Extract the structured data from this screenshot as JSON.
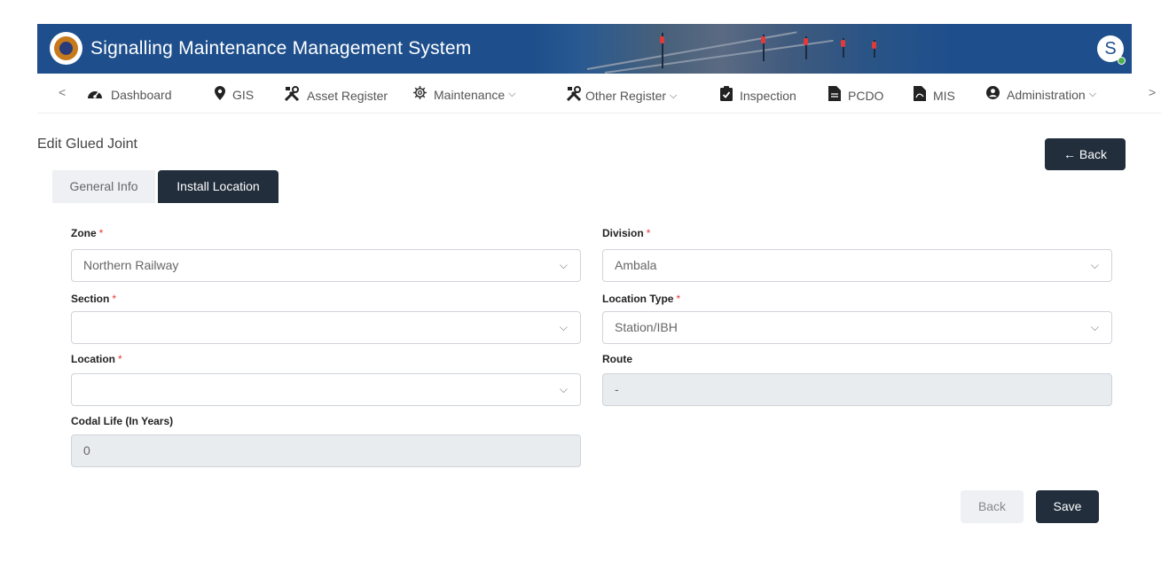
{
  "header": {
    "app_title": "Signalling Maintenance Management System",
    "avatar_initial": "S",
    "brand_color": "#1e4f8c"
  },
  "nav": {
    "prev_arrow": "<",
    "next_arrow": ">",
    "items": [
      {
        "label": "Dashboard",
        "icon": "dashboard-gauge-icon"
      },
      {
        "label": "GIS",
        "icon": "map-pin-icon"
      },
      {
        "label": "Asset Register",
        "icon": "tools-icon"
      },
      {
        "label": "Maintenance",
        "icon": "gear-icon",
        "has_dropdown": true
      },
      {
        "label": "Other Register",
        "icon": "tools-icon",
        "has_dropdown": true
      },
      {
        "label": "Inspection",
        "icon": "clipboard-check-icon"
      },
      {
        "label": "PCDO",
        "icon": "document-icon"
      },
      {
        "label": "MIS",
        "icon": "pdf-file-icon"
      },
      {
        "label": "Administration",
        "icon": "user-circle-icon",
        "has_dropdown": true
      }
    ]
  },
  "page": {
    "title": "Edit Glued Joint",
    "back_button": "← Back"
  },
  "tabs": [
    {
      "label": "General Info",
      "active": false
    },
    {
      "label": "Install Location",
      "active": true
    }
  ],
  "form": {
    "zone": {
      "label": "Zone",
      "required_mark": "*",
      "value": "Northern Railway"
    },
    "division": {
      "label": "Division",
      "required_mark": "*",
      "value": "Ambala"
    },
    "section": {
      "label": "Section",
      "required_mark": "*",
      "value": ""
    },
    "location_type": {
      "label": "Location Type",
      "required_mark": "*",
      "value": "Station/IBH"
    },
    "location": {
      "label": "Location",
      "required_mark": "*",
      "value": ""
    },
    "route": {
      "label": "Route",
      "value": "-"
    },
    "codal_life": {
      "label": "Codal Life (In Years)",
      "value": "0"
    }
  },
  "actions": {
    "back": "Back",
    "save": "Save"
  },
  "colors": {
    "dark_button": "#222e3c",
    "required": "#e53935",
    "online_dot": "#4caf50"
  }
}
